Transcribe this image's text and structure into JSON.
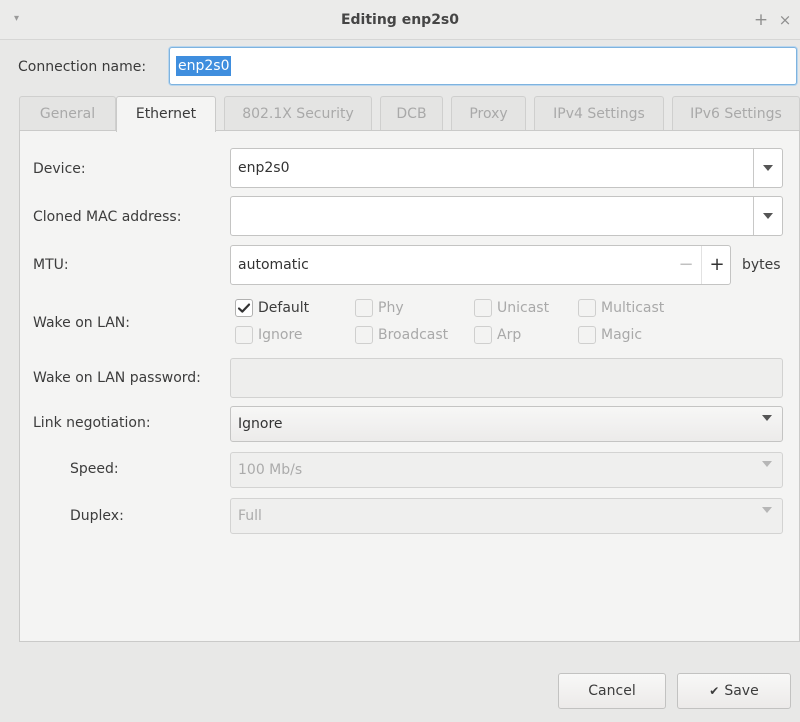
{
  "window": {
    "title": "Editing enp2s0",
    "maximize_glyph": "+",
    "close_glyph": "×",
    "menu_glyph": "▾"
  },
  "connection": {
    "label": "Connection name:",
    "value": "enp2s0"
  },
  "tabs": [
    {
      "label": "General"
    },
    {
      "label": "Ethernet"
    },
    {
      "label": "802.1X Security"
    },
    {
      "label": "DCB"
    },
    {
      "label": "Proxy"
    },
    {
      "label": "IPv4 Settings"
    },
    {
      "label": "IPv6 Settings"
    }
  ],
  "ethernet": {
    "device_label": "Device:",
    "device_value": "enp2s0",
    "cloned_mac_label": "Cloned MAC address:",
    "cloned_mac_value": "",
    "mtu_label": "MTU:",
    "mtu_value": "automatic",
    "mtu_minus": "−",
    "mtu_plus": "+",
    "mtu_unit": "bytes",
    "wol_label": "Wake on LAN:",
    "wol_options": [
      {
        "label": "Default",
        "checked": true,
        "enabled": true
      },
      {
        "label": "Phy",
        "checked": false,
        "enabled": false
      },
      {
        "label": "Unicast",
        "checked": false,
        "enabled": false
      },
      {
        "label": "Multicast",
        "checked": false,
        "enabled": false
      },
      {
        "label": "Ignore",
        "checked": false,
        "enabled": false
      },
      {
        "label": "Broadcast",
        "checked": false,
        "enabled": false
      },
      {
        "label": "Arp",
        "checked": false,
        "enabled": false
      },
      {
        "label": "Magic",
        "checked": false,
        "enabled": false
      }
    ],
    "wol_password_label": "Wake on LAN password:",
    "wol_password_value": "",
    "link_negotiation_label": "Link negotiation:",
    "link_negotiation_value": "Ignore",
    "speed_label": "Speed:",
    "speed_value": "100 Mb/s",
    "duplex_label": "Duplex:",
    "duplex_value": "Full"
  },
  "buttons": {
    "cancel": "Cancel",
    "save": "Save",
    "save_glyph": "✔"
  }
}
